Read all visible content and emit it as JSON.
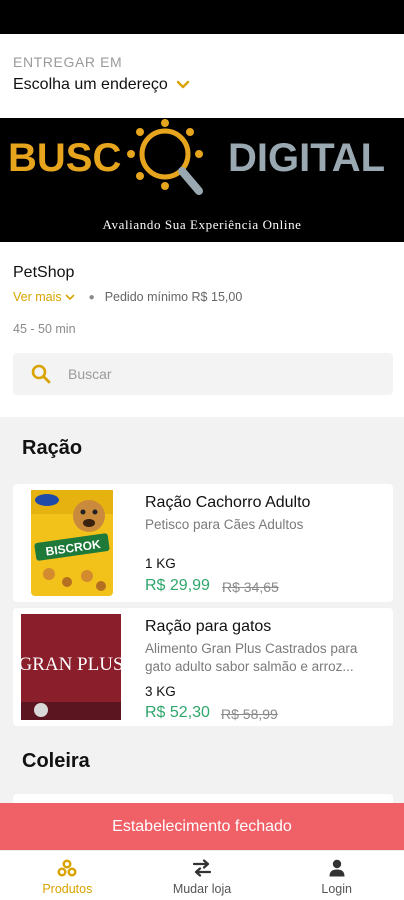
{
  "delivery": {
    "label": "ENTREGAR EM",
    "address": "Escolha um endereço"
  },
  "banner": {
    "brand_left": "BUSC",
    "brand_right": "DIGITAL",
    "tagline": "Avaliando Sua Experiência Online"
  },
  "store": {
    "name": "PetShop",
    "more_label": "Ver mais",
    "min_order": "Pedido mínimo R$ 15,00",
    "eta": "45 - 50 min"
  },
  "search": {
    "placeholder": "Buscar"
  },
  "sections": [
    {
      "title": "Ração",
      "products": [
        {
          "name": "Ração Cachorro Adulto",
          "description": "Petisco para Cães Adultos",
          "unit": "1 KG",
          "price": "R$ 29,99",
          "old_price": "R$ 34,65",
          "image_text": "BISCROK"
        },
        {
          "name": "Ração para gatos",
          "description": "Alimento Gran Plus Castrados para gato adulto sabor salmão e arroz...",
          "unit": "3 KG",
          "price": "R$ 52,30",
          "old_price": "R$ 58,99",
          "image_text": "GRAN PLUS"
        }
      ]
    },
    {
      "title": "Coleira"
    }
  ],
  "closed_banner": "Estabelecimento fechado",
  "tabs": [
    {
      "label": "Produtos",
      "icon": "products-icon"
    },
    {
      "label": "Mudar loja",
      "icon": "swap-icon"
    },
    {
      "label": "Login",
      "icon": "user-icon"
    }
  ],
  "colors": {
    "accent": "#d9a300",
    "price": "#2fa66b",
    "closed": "#f06067"
  }
}
